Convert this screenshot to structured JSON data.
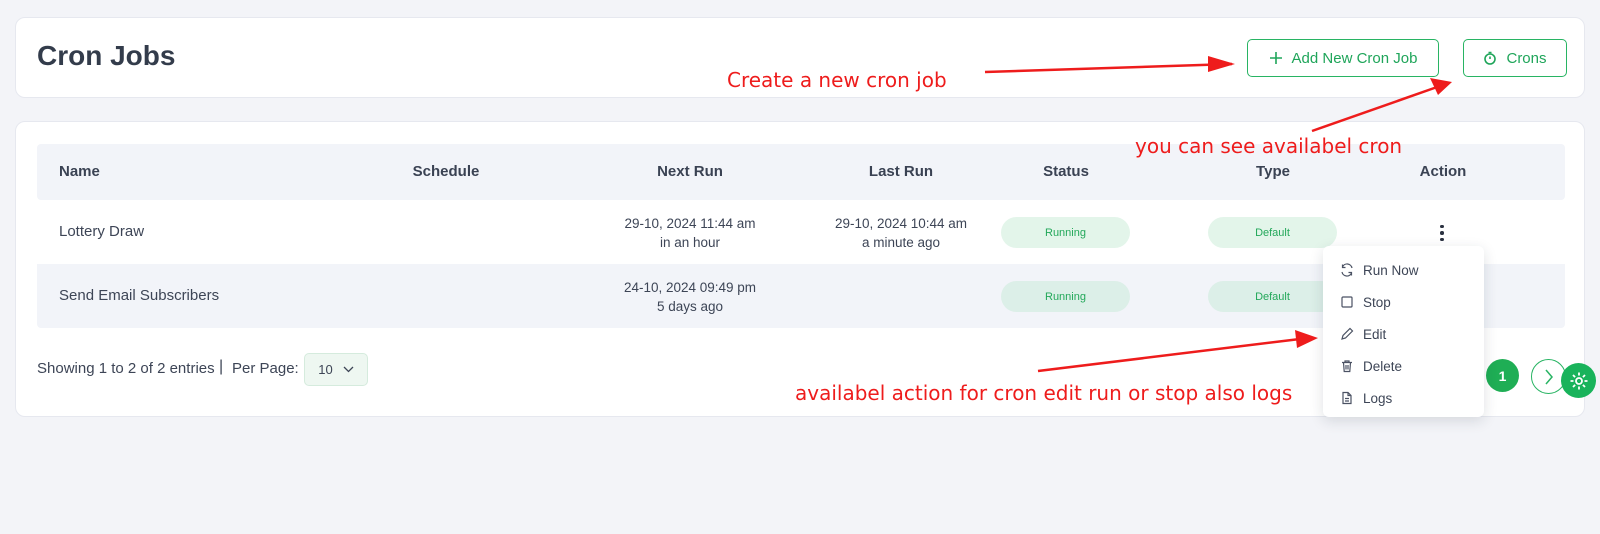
{
  "header": {
    "title": "Cron Jobs",
    "add_button_label": "Add New Cron Job",
    "crons_button_label": "Crons"
  },
  "table": {
    "columns": [
      "Name",
      "Schedule",
      "Next Run",
      "Last Run",
      "Status",
      "Type",
      "Action"
    ],
    "rows": [
      {
        "name": "Lottery Draw",
        "schedule": "",
        "next_run": "29-10, 2024 11:44 am",
        "next_run_rel": "in an hour",
        "last_run": "29-10, 2024 10:44 am",
        "last_run_rel": "a minute ago",
        "status": "Running",
        "type": "Default"
      },
      {
        "name": "Send Email Subscribers",
        "schedule": "",
        "next_run": "24-10, 2024 09:49 pm",
        "next_run_rel": "5 days ago",
        "last_run": "",
        "last_run_rel": "",
        "status": "Running",
        "type": "Default"
      }
    ]
  },
  "footer": {
    "showing": "Showing 1 to 2 of 2 entries",
    "separator": "|",
    "per_page_label": "Per Page:",
    "per_page_value": "10",
    "current_page": "1"
  },
  "action_menu": {
    "items": [
      {
        "label": "Run Now",
        "icon": "refresh-icon"
      },
      {
        "label": "Stop",
        "icon": "stop-icon"
      },
      {
        "label": "Edit",
        "icon": "pencil-icon"
      },
      {
        "label": "Delete",
        "icon": "trash-icon"
      },
      {
        "label": "Logs",
        "icon": "file-icon"
      }
    ]
  },
  "annotations": {
    "create": "Create a new cron job",
    "crons": "you can see availabel cron",
    "actions": "availabel action for cron edit run or stop also logs"
  },
  "colors": {
    "accent": "#1fae55",
    "annotation": "#ee1c1c",
    "badge_bg": "#e3f5ea"
  }
}
